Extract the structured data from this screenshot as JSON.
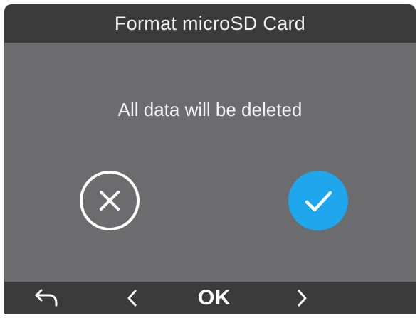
{
  "dialog": {
    "title": "Format microSD Card",
    "message": "All data will be deleted"
  },
  "choices": {
    "cancel_icon": "circle-x-icon",
    "confirm_icon": "circle-check-icon",
    "confirm_color": "#1ea7ec"
  },
  "nav": {
    "back_icon": "return-arrow-icon",
    "left_icon": "chevron-left-icon",
    "ok_label": "OK",
    "right_icon": "chevron-right-icon"
  },
  "colors": {
    "background": "#6c6c6e",
    "bars": "#3b3b3b",
    "text": "#ffffff"
  }
}
